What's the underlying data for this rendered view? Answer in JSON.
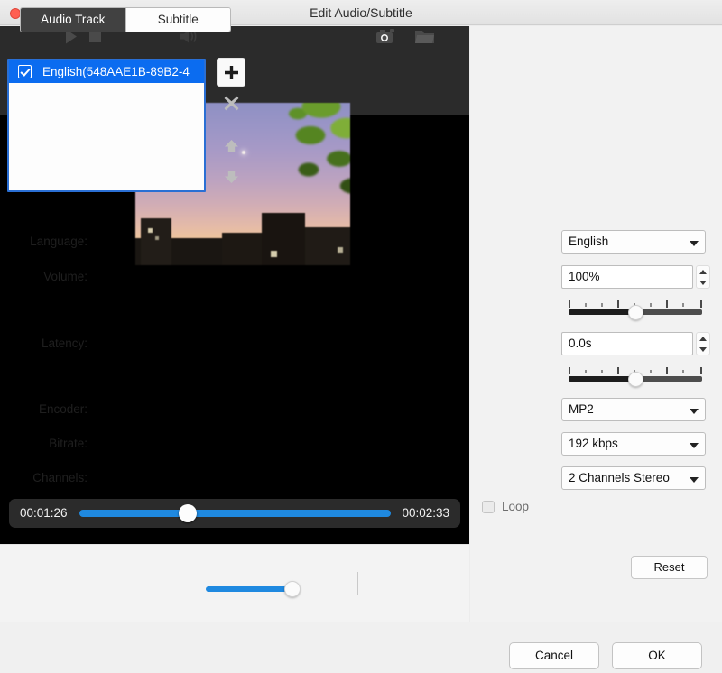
{
  "window": {
    "title": "Edit Audio/Subtitle",
    "close_icon": "close-dot-icon"
  },
  "player": {
    "current_time": "00:01:26",
    "total_time": "00:02:33",
    "seek_percent": 32,
    "volume_percent": 84,
    "controls": [
      {
        "name": "play-button",
        "icon": "play-icon"
      },
      {
        "name": "stop-button",
        "icon": "stop-icon"
      },
      {
        "name": "volume-button",
        "icon": "speaker-icon"
      },
      {
        "name": "snapshot-button",
        "icon": "camera-icon"
      },
      {
        "name": "open-folder-button",
        "icon": "folder-icon"
      }
    ]
  },
  "panel": {
    "tabs": [
      {
        "label": "Audio Track",
        "active": true
      },
      {
        "label": "Subtitle",
        "active": false
      }
    ],
    "track_list": [
      {
        "label": "English(548AAE1B-89B2-4",
        "checked": true,
        "selected": true
      }
    ],
    "list_buttons": [
      {
        "name": "add-track-button",
        "icon": "plus-icon",
        "enabled": true
      },
      {
        "name": "remove-track-button",
        "icon": "close-x-icon",
        "enabled": false
      },
      {
        "name": "move-up-button",
        "icon": "arrow-up-icon",
        "enabled": false
      },
      {
        "name": "move-down-button",
        "icon": "arrow-down-icon",
        "enabled": false
      }
    ],
    "fields": {
      "language": {
        "label": "Language:",
        "value": "English"
      },
      "volume": {
        "label": "Volume:",
        "value": "100%"
      },
      "latency": {
        "label": "Latency:",
        "value": "0.0s"
      },
      "encoder": {
        "label": "Encoder:",
        "value": "MP2"
      },
      "bitrate": {
        "label": "Bitrate:",
        "value": "192 kbps"
      },
      "channels": {
        "label": "Channels:",
        "value": "2 Channels Stereo"
      }
    },
    "loop": {
      "label": "Loop",
      "checked": false
    },
    "reset_label": "Reset"
  },
  "footer": {
    "cancel_label": "Cancel",
    "ok_label": "OK"
  },
  "colors": {
    "accent_blue": "#1f89e0",
    "selection_blue": "#0b6cf0",
    "tab_active_bg": "#414141",
    "panel_bg": "#f2f2f2",
    "video_bg": "#000000",
    "close_red": "#ff5f52"
  }
}
